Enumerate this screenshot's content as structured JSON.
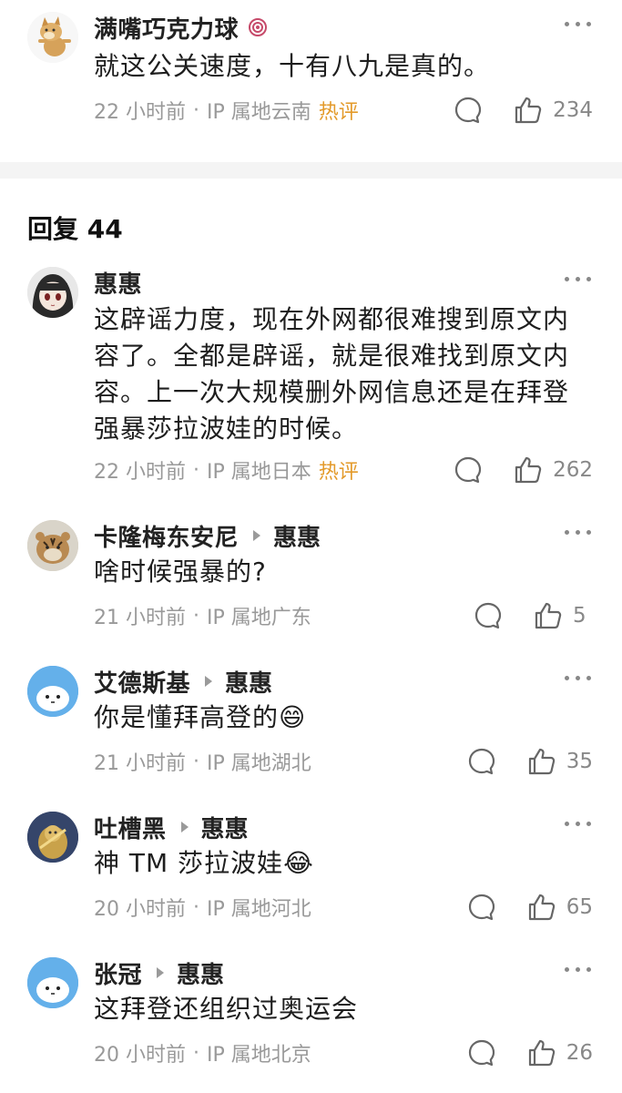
{
  "top_comment": {
    "username": "满嘴巧克力球",
    "text": "就这公关速度，十有八九是真的。",
    "time": "22 小时前",
    "ip": "IP 属地云南",
    "hot_label": "热评",
    "likes": "234",
    "avatar_icon": "shiba-dog-avatar",
    "badge_icon": "badge-icon"
  },
  "replies_header": "回复 44",
  "replies": [
    {
      "username": "惠惠",
      "reply_to": "",
      "text": "这辟谣力度，现在外网都很难搜到原文内容了。全都是辟谣，就是很难找到原文内容。上一次大规模删外网信息还是在拜登强暴莎拉波娃的时候。",
      "time": "22 小时前",
      "ip": "IP 属地日本",
      "hot_label": "热评",
      "likes": "262"
    },
    {
      "username": "卡隆梅东安尼",
      "reply_to": "惠惠",
      "text": "啥时候强暴的?",
      "time": "21 小时前",
      "ip": "IP 属地广东",
      "hot_label": "",
      "likes": "5"
    },
    {
      "username": "艾德斯基",
      "reply_to": "惠惠",
      "text": "你是懂拜高登的😄",
      "time": "21 小时前",
      "ip": "IP 属地湖北",
      "hot_label": "",
      "likes": "35"
    },
    {
      "username": "吐槽黑",
      "reply_to": "惠惠",
      "text": "神 TM 莎拉波娃😂",
      "time": "20 小时前",
      "ip": "IP 属地河北",
      "hot_label": "",
      "likes": "65"
    },
    {
      "username": "张冠",
      "reply_to": "惠惠",
      "text": "这拜登还组织过奥运会",
      "time": "20 小时前",
      "ip": "IP 属地北京",
      "hot_label": "",
      "likes": "26"
    }
  ],
  "meta_separator": "·",
  "colors": {
    "hot": "#e39a2a",
    "meta": "#999999",
    "divider": "#f4f4f4"
  }
}
